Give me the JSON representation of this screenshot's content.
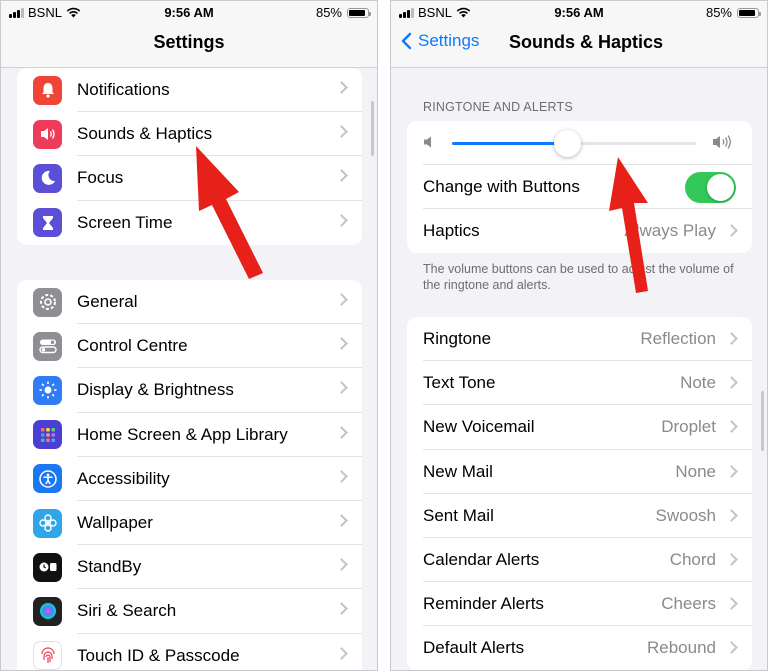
{
  "colors": {
    "accent": "#0a7aff",
    "toggle_on": "#34c759",
    "arrow": "#e8201a"
  },
  "left": {
    "status": {
      "carrier": "BSNL",
      "time": "9:56 AM",
      "battery": "85%",
      "battery_level": 0.85
    },
    "title": "Settings",
    "group1": [
      {
        "label": "Notifications",
        "icon": "bell-icon",
        "color": "#f04438"
      },
      {
        "label": "Sounds & Haptics",
        "icon": "speaker-icon",
        "color": "#f03a5a"
      },
      {
        "label": "Focus",
        "icon": "moon-icon",
        "color": "#5b4fd8"
      },
      {
        "label": "Screen Time",
        "icon": "hourglass-icon",
        "color": "#5b4fd8"
      }
    ],
    "group2": [
      {
        "label": "General",
        "icon": "gear-icon",
        "color": "#8e8e93"
      },
      {
        "label": "Control Centre",
        "icon": "toggles-icon",
        "color": "#8e8e93"
      },
      {
        "label": "Display & Brightness",
        "icon": "sun-icon",
        "color": "#2f7cf6"
      },
      {
        "label": "Home Screen & App Library",
        "icon": "grid-icon",
        "color": "#4a3fd0"
      },
      {
        "label": "Accessibility",
        "icon": "accessibility-icon",
        "color": "#1a78f2"
      },
      {
        "label": "Wallpaper",
        "icon": "flower-icon",
        "color": "#2fa6e8"
      },
      {
        "label": "StandBy",
        "icon": "standby-icon",
        "color": "#111111"
      },
      {
        "label": "Siri & Search",
        "icon": "siri-icon",
        "color": "#222222"
      },
      {
        "label": "Touch ID & Passcode",
        "icon": "fingerprint-icon",
        "color": "#ffffff"
      }
    ]
  },
  "right": {
    "status": {
      "carrier": "BSNL",
      "time": "9:56 AM",
      "battery": "85%",
      "battery_level": 0.85
    },
    "back_label": "Settings",
    "title": "Sounds & Haptics",
    "section_header": "RINGTONE AND ALERTS",
    "volume_level": 0.47,
    "change_with_buttons": "Change with Buttons",
    "change_with_buttons_on": true,
    "haptics": {
      "label": "Haptics",
      "value": "Always Play"
    },
    "footer": "The volume buttons can be used to adjust the volume of the ringtone and alerts.",
    "tones": [
      {
        "label": "Ringtone",
        "value": "Reflection"
      },
      {
        "label": "Text Tone",
        "value": "Note"
      },
      {
        "label": "New Voicemail",
        "value": "Droplet"
      },
      {
        "label": "New Mail",
        "value": "None"
      },
      {
        "label": "Sent Mail",
        "value": "Swoosh"
      },
      {
        "label": "Calendar Alerts",
        "value": "Chord"
      },
      {
        "label": "Reminder Alerts",
        "value": "Cheers"
      },
      {
        "label": "Default Alerts",
        "value": "Rebound"
      }
    ]
  }
}
